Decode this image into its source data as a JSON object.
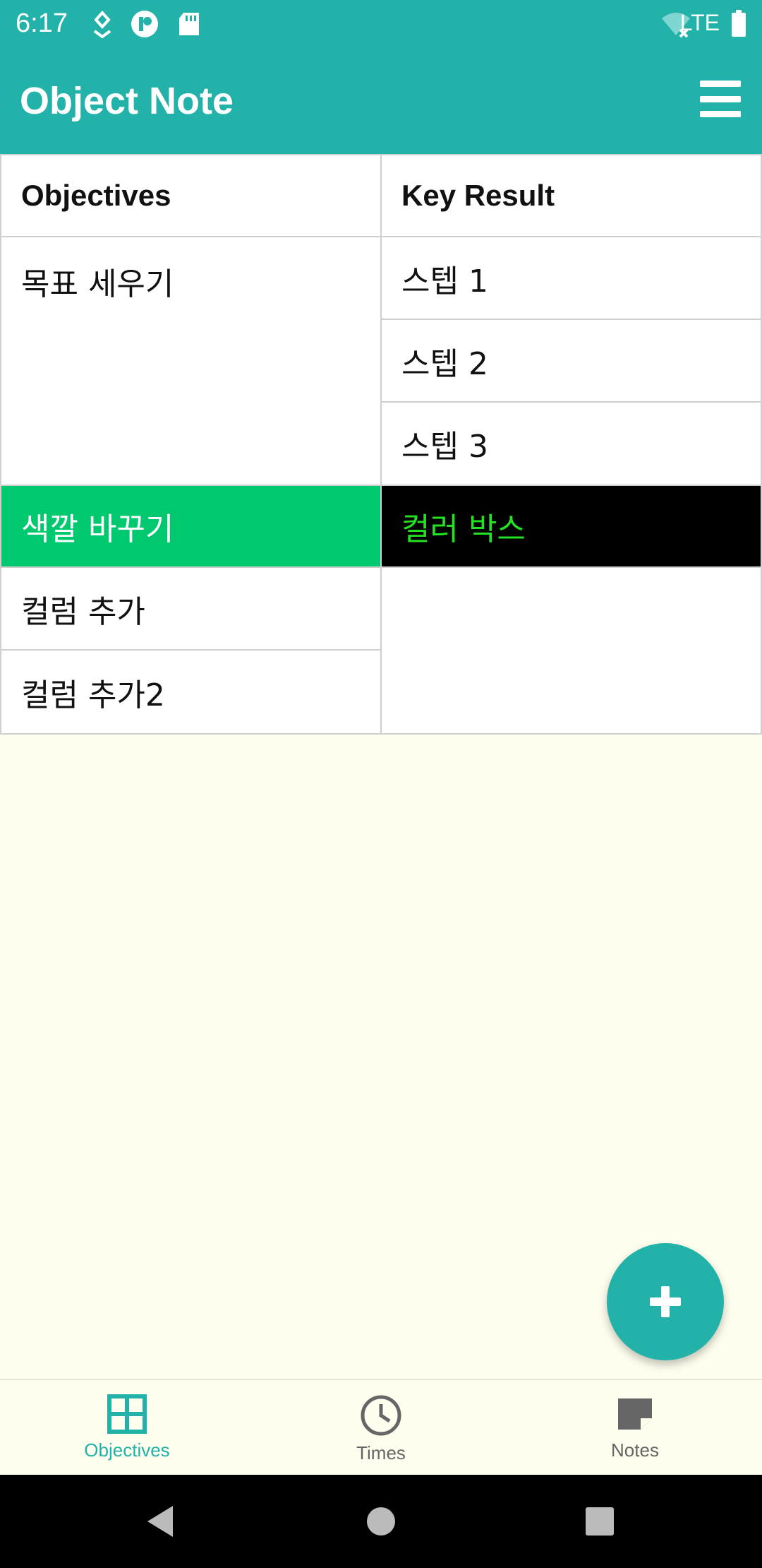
{
  "status_bar": {
    "time": "6:17",
    "network": "LTE",
    "icons": [
      "location-icon",
      "app-icon",
      "sd-card-icon",
      "wifi-off-icon",
      "battery-icon"
    ]
  },
  "app_bar": {
    "title": "Object Note",
    "menu_icon": "hamburger-menu-icon"
  },
  "table": {
    "headers": [
      "Objectives",
      "Key Result"
    ],
    "rows": [
      {
        "objective": "목표 세우기",
        "key_results": [
          "스텝 1",
          "스텝 2",
          "스텝 3"
        ]
      },
      {
        "objective": "색깔 바꾸기",
        "key_results": [
          "컬러 박스"
        ],
        "objective_bg": "#00C86E",
        "objective_color": "#FFFFFF",
        "kr_bg": "#000000",
        "kr_color": "#22E222"
      },
      {
        "objectives": [
          "컬럼 추가",
          "컬럼 추가2"
        ],
        "key_results": [
          ""
        ]
      }
    ]
  },
  "fab": {
    "icon": "plus-icon"
  },
  "bottom_nav": {
    "items": [
      {
        "label": "Objectives",
        "icon": "grid-icon",
        "active": true
      },
      {
        "label": "Times",
        "icon": "clock-icon",
        "active": false
      },
      {
        "label": "Notes",
        "icon": "note-icon",
        "active": false
      }
    ]
  },
  "colors": {
    "primary": "#22B2AA",
    "background": "#FEFEEE",
    "inactive": "#666666"
  }
}
